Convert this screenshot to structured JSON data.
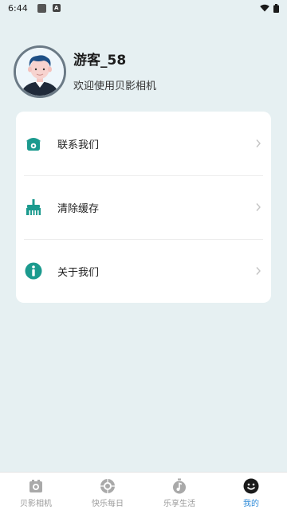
{
  "status_bar": {
    "time": "6:44",
    "notif_letter": "A"
  },
  "profile": {
    "username": "游客_58",
    "welcome": "欢迎使用贝影相机"
  },
  "menu": {
    "items": [
      {
        "label": "联系我们",
        "icon": "phone-icon"
      },
      {
        "label": "清除缓存",
        "icon": "broom-icon"
      },
      {
        "label": "关于我们",
        "icon": "info-icon"
      }
    ]
  },
  "tabs": [
    {
      "label": "贝影相机",
      "icon": "camera-icon",
      "active": false
    },
    {
      "label": "快乐每日",
      "icon": "aperture-icon",
      "active": false
    },
    {
      "label": "乐享生活",
      "icon": "music-timer-icon",
      "active": false
    },
    {
      "label": "我的",
      "icon": "smiley-face-icon",
      "active": true
    }
  ],
  "colors": {
    "accent_icon": "#1b9a8e",
    "active_tab": "#2f8bd8",
    "background": "#e6f0f2"
  }
}
